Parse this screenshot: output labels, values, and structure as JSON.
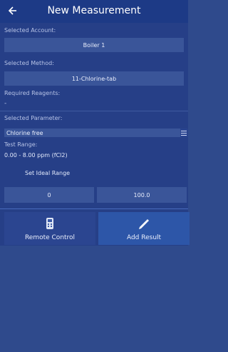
{
  "header": {
    "title": "New Measurement"
  },
  "account": {
    "label": "Selected Account:",
    "value": "Boiler 1"
  },
  "method": {
    "label": "Selected Method:",
    "value": "11-Chlorine-tab"
  },
  "reagents": {
    "label": "Required Reagents:",
    "value": "-"
  },
  "parameter": {
    "label": "Selected Parameter:",
    "value": "Chlorine free"
  },
  "test_range": {
    "label": "Test Range:",
    "value": "0.00 - 8.00 ppm (fCl2)"
  },
  "ideal_range": {
    "button_label": "Set Ideal Range",
    "min": "0",
    "max": "100.0"
  },
  "actions": {
    "remote_control": "Remote Control",
    "add_result": "Add Result"
  },
  "colors": {
    "header": "#1d3a86",
    "panel": "#263f87",
    "field": "#3a5599",
    "highlight": "#2d56a8",
    "background": "#2f4a8c"
  },
  "icons": {
    "back": "arrow-left-icon",
    "remote": "handset-icon",
    "add": "pencil-icon",
    "param_action": "list-icon"
  }
}
